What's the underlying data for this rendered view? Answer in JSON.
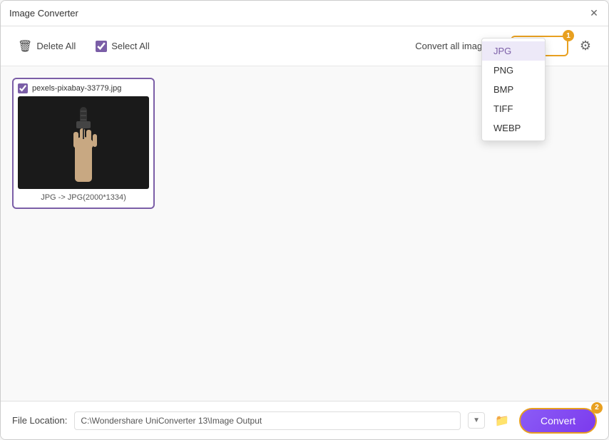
{
  "window": {
    "title": "Image Converter"
  },
  "toolbar": {
    "delete_all_label": "Delete All",
    "select_all_label": "Select All",
    "convert_all_label": "Convert all images to:",
    "selected_format": "JPG",
    "badge_number": "1"
  },
  "formats": {
    "options": [
      "JPG",
      "PNG",
      "BMP",
      "TIFF",
      "WEBP"
    ],
    "selected": "JPG"
  },
  "image_card": {
    "filename": "pexels-pixabay-33779.jpg",
    "caption": "JPG -> JPG(2000*1334)"
  },
  "footer": {
    "file_location_label": "File Location:",
    "file_path": "C:\\Wondershare UniConverter 13\\Image Output",
    "convert_label": "Convert",
    "badge_number": "2"
  }
}
